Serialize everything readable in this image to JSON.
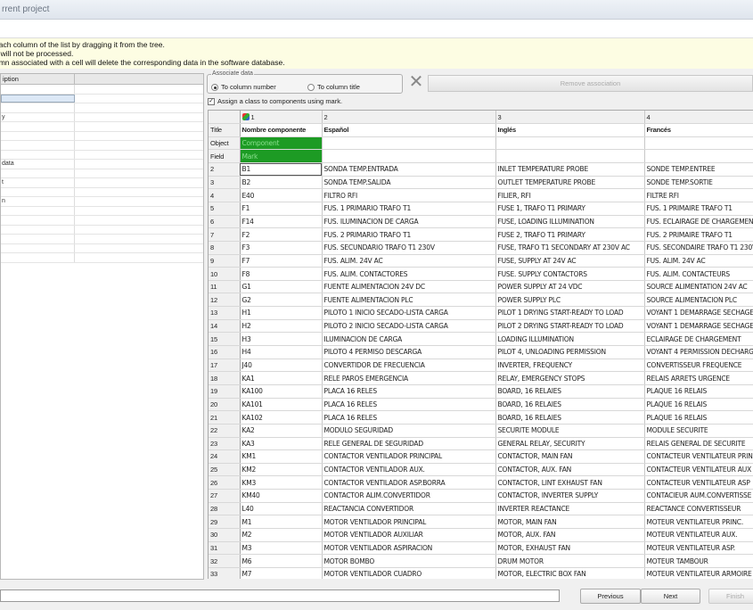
{
  "window": {
    "title": "rrent project"
  },
  "info": {
    "lines": [
      "each column of the list by dragging it from the tree.",
      "s will not be processed.",
      "umn associated with a cell will delete the corresponding data in the software database."
    ]
  },
  "left_panel": {
    "header": "iption",
    "items": [
      "",
      "",
      "",
      "y",
      "",
      "",
      "",
      "",
      "data",
      "",
      "t",
      "",
      "n",
      "",
      "",
      "",
      "",
      "",
      ""
    ]
  },
  "associate": {
    "title": "Associate data",
    "option_number": "To column number",
    "option_title": "To column title",
    "remove_label": "Remove association",
    "assign_label": "Assign a class to components using mark."
  },
  "grid": {
    "col_numbers": [
      "",
      "1",
      "2",
      "3",
      "4"
    ],
    "headers": [
      "Title",
      "Nombre componente",
      "Español",
      "Inglés",
      "Francés"
    ],
    "object_row": [
      "Object",
      "Component",
      "",
      "",
      ""
    ],
    "field_row": [
      "Field",
      "Mark",
      "",
      "",
      ""
    ],
    "rows": [
      [
        "2",
        "B1",
        "SONDA TEMP.ENTRADA",
        "INLET TEMPERATURE PROBE",
        "SONDE TEMP.ENTREE"
      ],
      [
        "3",
        "B2",
        "SONDA TEMP.SALIDA",
        "OUTLET TEMPERATURE PROBE",
        "SONDE TEMP.SORTIE"
      ],
      [
        "4",
        "E40",
        "FILTRO RFI",
        "FILIER, RFI",
        "FILTRE RFI"
      ],
      [
        "5",
        "F1",
        "FUS. 1 PRIMARIO TRAFO T1",
        "FUSE 1, TRAFO T1 PRIMARY",
        "FUS. 1 PRIMAIRE TRAFO T1"
      ],
      [
        "6",
        "F14",
        "FUS. ILUMINACION DE CARGA",
        "FUSE, LOADING ILLUMINATION",
        "FUS. ECLAIRAGE DE CHARGEMENT"
      ],
      [
        "7",
        "F2",
        "FUS. 2 PRIMARIO TRAFO T1",
        "FUSE 2, TRAFO T1 PRIMARY",
        "FUS. 2 PRIMAIRE TRAFO T1"
      ],
      [
        "8",
        "F3",
        "FUS. SECUNDARIO TRAFO T1 230V",
        "FUSE, TRAFO T1 SECONDARY AT 230V AC",
        "FUS. SECONDAIRE TRAFO T1 230V"
      ],
      [
        "9",
        "F7",
        "FUS. ALIM. 24V AC",
        "FUSE, SUPPLY AT 24V AC",
        "FUS. ALIM. 24V AC"
      ],
      [
        "10",
        "F8",
        "FUS. ALIM. CONTACTORES",
        "FUSE. SUPPLY CONTACTORS",
        "FUS. ALIM. CONTACTEURS"
      ],
      [
        "11",
        "G1",
        "FUENTE ALIMENTACION 24V DC",
        "POWER SUPPLY AT 24 VDC",
        "SOURCE ALIMENTATION 24V AC"
      ],
      [
        "12",
        "G2",
        "FUENTE ALIMENTACION PLC",
        "POWER SUPPLY PLC",
        "SOURCE ALIMENTACION PLC"
      ],
      [
        "13",
        "H1",
        "PILOTO 1 INICIO SECADO-LISTA CARGA",
        "PILOT 1 DRYING START-READY TO LOAD",
        "VOYANT 1 DEMARRAGE SECHAGE"
      ],
      [
        "14",
        "H2",
        "PILOTO 2 INICIO SECADO-LISTA CARGA",
        "PILOT 2 DRYING START-READY TO LOAD",
        "VOYANT 1 DEMARRAGE SECHAGE"
      ],
      [
        "15",
        "H3",
        "ILUMINACION DE CARGA",
        "LOADING ILLUMINATION",
        "ECLAIRAGE DE CHARGEMENT"
      ],
      [
        "16",
        "H4",
        "PILOTO 4 PERMISO DESCARGA",
        "PILOT 4, UNLOADING PERMISSION",
        "VOYANT 4 PERMISSION DECHARG"
      ],
      [
        "17",
        "J40",
        "CONVERTIDOR DE FRECUENCIA",
        "INVERTER, FREQUENCY",
        "CONVERTISSEUR FREQUENCE"
      ],
      [
        "18",
        "KA1",
        "RELE PAROS EMERGENCIA",
        "RELAY, EMERGENCY STOPS",
        "RELAIS ARRETS URGENCE"
      ],
      [
        "19",
        "KA100",
        "PLACA 16 RELES",
        "BOARD, 16 RELAIES",
        "PLAQUE 16 RELAIS"
      ],
      [
        "20",
        "KA101",
        "PLACA 16 RELES",
        "BOARD, 16 RELAIES",
        "PLAQUE 16 RELAIS"
      ],
      [
        "21",
        "KA102",
        "PLACA 16 RELES",
        "BOARD, 16 RELAIES",
        "PLAQUE 16 RELAIS"
      ],
      [
        "22",
        "KA2",
        "MODULO SEGURIDAD",
        "SECURITE MODULE",
        "MODULE SECURITE"
      ],
      [
        "23",
        "KA3",
        "RELE GENERAL DE SEGURIDAD",
        "GENERAL RELAY, SECURITY",
        "RELAIS GENERAL DE SECURITE"
      ],
      [
        "24",
        "KM1",
        "CONTACTOR VENTILADOR PRINCIPAL",
        "CONTACTOR, MAIN FAN",
        "CONTACTEUR VENTILATEUR PRIN"
      ],
      [
        "25",
        "KM2",
        "CONTACTOR VENTILADOR AUX.",
        "CONTACTOR, AUX. FAN",
        "CONTACTEUR VENTILATEUR AUX"
      ],
      [
        "26",
        "KM3",
        "CONTACTOR VENTILADOR ASP.BORRA",
        "CONTACTOR, LINT EXHAUST FAN",
        "CONTACTEUR VENTILATEUR ASP"
      ],
      [
        "27",
        "KM40",
        "CONTACTOR ALIM.CONVERTIDOR",
        "CONTACTOR, INVERTER SUPPLY",
        "CONTACIEUR AUM.CONVERTISSE"
      ],
      [
        "28",
        "L40",
        "REACTANCIA CONVERTIDOR",
        "INVERTER REACTANCE",
        "REACTANCE CONVERTISSEUR"
      ],
      [
        "29",
        "M1",
        "MOTOR VENTILADOR PRINCIPAL",
        "MOTOR, MAIN FAN",
        "MOTEUR VENTILATEUR PRINC."
      ],
      [
        "30",
        "M2",
        "MOTOR VENTILADOR AUXILIAR",
        "MOTOR, AUX. FAN",
        "MOTEUR VENTILATEUR AUX."
      ],
      [
        "31",
        "M3",
        "MOTOR VENTILADOR ASPIRACION",
        "MOTOR, EXHAUST FAN",
        "MOTEUR VENTILATEUR ASP."
      ],
      [
        "32",
        "M6",
        "MOTOR BOMBO",
        "DRUM MOTOR",
        "MOTEUR TAMBOUR"
      ],
      [
        "33",
        "M7",
        "MOTOR VENTILADOR CUADRO",
        "MOTOR, ELECTRIC BOX FAN",
        "MOTEUR VENTILATEUR ARMOIRE"
      ]
    ]
  },
  "footer": {
    "previous": "Previous",
    "next": "Next",
    "finish": "Finish"
  }
}
